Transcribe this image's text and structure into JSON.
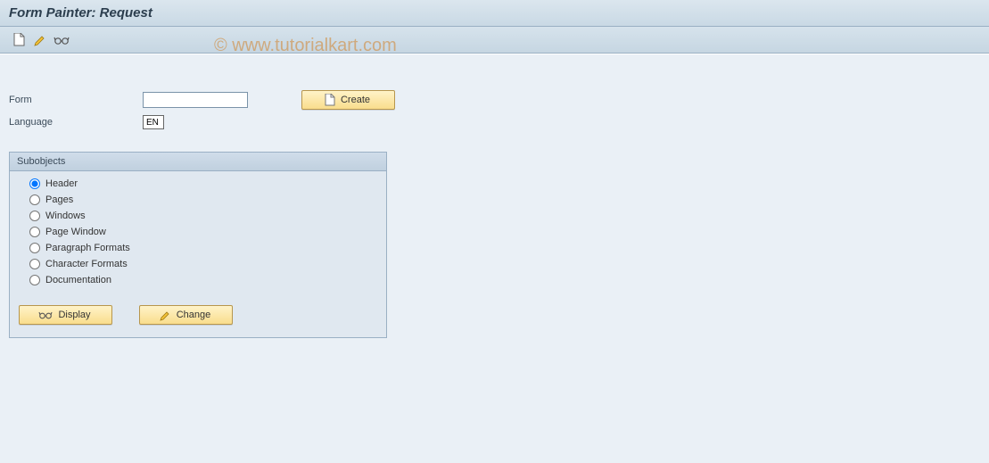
{
  "title": "Form Painter: Request",
  "toolbar": {
    "new_icon": "new",
    "edit_icon": "pencil",
    "glasses_icon": "glasses"
  },
  "fields": {
    "form_label": "Form",
    "form_value": "",
    "language_label": "Language",
    "language_value": "EN"
  },
  "buttons": {
    "create": "Create",
    "display": "Display",
    "change": "Change"
  },
  "subobjects": {
    "title": "Subobjects",
    "options": [
      {
        "label": "Header",
        "selected": true
      },
      {
        "label": "Pages",
        "selected": false
      },
      {
        "label": "Windows",
        "selected": false
      },
      {
        "label": "Page Window",
        "selected": false
      },
      {
        "label": "Paragraph Formats",
        "selected": false
      },
      {
        "label": "Character Formats",
        "selected": false
      },
      {
        "label": "Documentation",
        "selected": false
      }
    ]
  },
  "watermark": "© www.tutorialkart.com"
}
